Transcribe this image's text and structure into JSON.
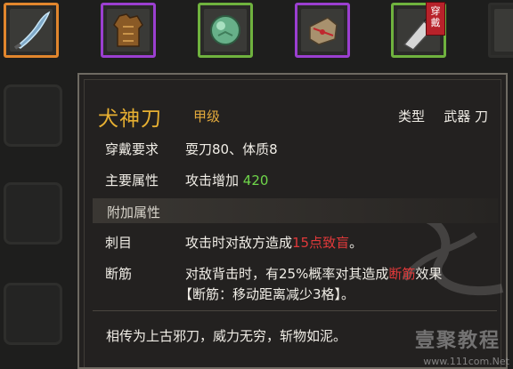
{
  "inventory": {
    "slots": [
      {
        "icon": "curved-blade-icon",
        "border": "#e1862d"
      },
      {
        "icon": "leather-vest-icon",
        "border": "#9b3fd0"
      },
      {
        "icon": "jade-orb-icon",
        "border": "#6fb23e"
      },
      {
        "icon": "bound-pouch-icon",
        "border": "#9b3fd0"
      },
      {
        "icon": "cleaver-icon",
        "border": "#6fb23e",
        "badge": "穿戴"
      }
    ]
  },
  "tooltip": {
    "name": "犬神刀",
    "grade": "甲级",
    "type_label": "类型",
    "type_value": "武器 刀",
    "requirements": {
      "label": "穿戴要求",
      "value": "耍刀80、体质8"
    },
    "main_attr": {
      "label": "主要属性",
      "value_prefix": "攻击增加",
      "value_number": "420"
    },
    "extra_section": "附加属性",
    "effects": [
      {
        "label": "刺目",
        "value_before": "攻击时对敌方造成",
        "value_highlight": "15点致盲",
        "value_after": "。"
      },
      {
        "label": "断筋",
        "value_before": "对敌背击时，有25%概率对其造成",
        "value_highlight": "断筋",
        "value_after": "效果",
        "detail": "【断筋：移动距离减少3格】。"
      }
    ],
    "flavor": "相传为上古邪刀，威力无穷，斩物如泥。"
  },
  "watermark": {
    "text": "壹聚教程",
    "url": "www.111com.Net"
  },
  "colors": {
    "name": "#e7b032",
    "value_green": "#6fd64a",
    "value_red": "#e0393a",
    "rarity_orange": "#e1862d",
    "rarity_purple": "#9b3fd0",
    "rarity_green": "#6fb23e"
  }
}
